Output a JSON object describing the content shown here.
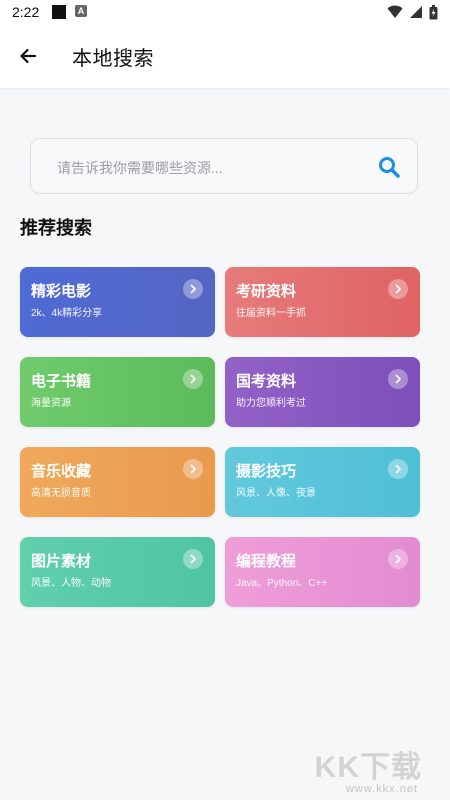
{
  "status_bar": {
    "time": "2:22",
    "icons": [
      "notification-square-icon",
      "a-icon",
      "wifi-icon",
      "signal-icon",
      "battery-icon"
    ]
  },
  "header": {
    "back_icon": "arrow-left-icon",
    "title": "本地搜索"
  },
  "search": {
    "placeholder": "请告诉我你需要哪些资源...",
    "value": "",
    "icon": "search-icon",
    "icon_color": "#1a8fe0"
  },
  "section": {
    "title": "推荐搜索"
  },
  "cards": [
    {
      "title": "精彩电影",
      "subtitle": "2k、4k精彩分享",
      "color": "#5567cf"
    },
    {
      "title": "考研资料",
      "subtitle": "往届资料一手抓",
      "color": "#e26a6a"
    },
    {
      "title": "电子书籍",
      "subtitle": "海量资源",
      "color": "#66c463"
    },
    {
      "title": "国考资料",
      "subtitle": "助力您顺利考过",
      "color": "#8857c1"
    },
    {
      "title": "音乐收藏",
      "subtitle": "高清无损音质",
      "color": "#eca255"
    },
    {
      "title": "摄影技巧",
      "subtitle": "风景、人像、夜景",
      "color": "#58c4d9"
    },
    {
      "title": "图片素材",
      "subtitle": "风景、人物、动物",
      "color": "#58caa8"
    },
    {
      "title": "编程教程",
      "subtitle": "Java、Python、C++",
      "color": "#e894d5"
    }
  ],
  "watermark": {
    "logo": "KK下载",
    "url": "www.kkx.net"
  }
}
